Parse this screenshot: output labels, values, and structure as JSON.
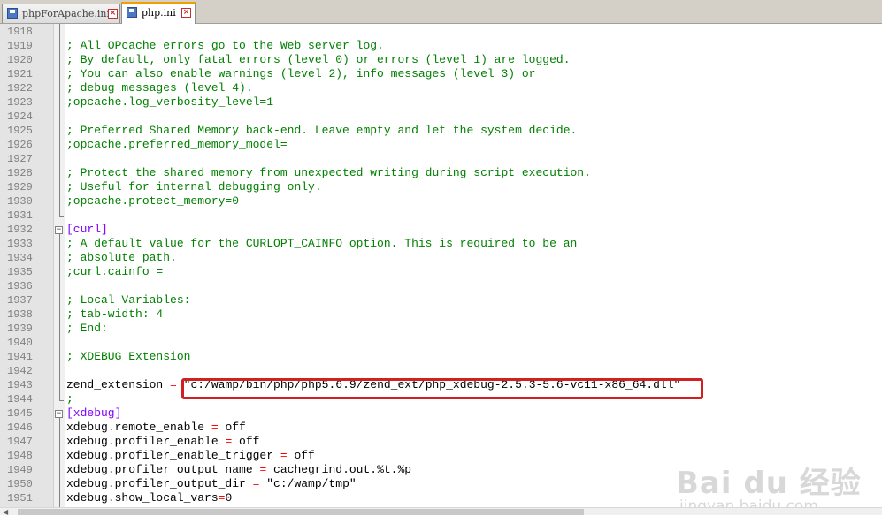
{
  "tabs": [
    {
      "label": "phpForApache.ini",
      "active": false
    },
    {
      "label": "php.ini",
      "active": true
    }
  ],
  "lines": [
    {
      "n": "1918",
      "parts": []
    },
    {
      "n": "1919",
      "parts": [
        {
          "t": "; All OPcache errors go to the Web server log.",
          "c": "c-comment"
        }
      ]
    },
    {
      "n": "1920",
      "parts": [
        {
          "t": "; By default, only fatal errors (level 0) or errors (level 1) are logged.",
          "c": "c-comment"
        }
      ]
    },
    {
      "n": "1921",
      "parts": [
        {
          "t": "; You can also enable warnings (level 2), info messages (level 3) or",
          "c": "c-comment"
        }
      ]
    },
    {
      "n": "1922",
      "parts": [
        {
          "t": "; debug messages (level 4).",
          "c": "c-comment"
        }
      ]
    },
    {
      "n": "1923",
      "parts": [
        {
          "t": ";opcache.log_verbosity_level=1",
          "c": "c-comment"
        }
      ]
    },
    {
      "n": "1924",
      "parts": []
    },
    {
      "n": "1925",
      "parts": [
        {
          "t": "; Preferred Shared Memory back-end. Leave empty and let the system decide.",
          "c": "c-comment"
        }
      ]
    },
    {
      "n": "1926",
      "parts": [
        {
          "t": ";opcache.preferred_memory_model=",
          "c": "c-comment"
        }
      ]
    },
    {
      "n": "1927",
      "parts": []
    },
    {
      "n": "1928",
      "parts": [
        {
          "t": "; Protect the shared memory from unexpected writing during script execution.",
          "c": "c-comment"
        }
      ]
    },
    {
      "n": "1929",
      "parts": [
        {
          "t": "; Useful for internal debugging only.",
          "c": "c-comment"
        }
      ]
    },
    {
      "n": "1930",
      "parts": [
        {
          "t": ";opcache.protect_memory=0",
          "c": "c-comment"
        }
      ]
    },
    {
      "n": "1931",
      "parts": []
    },
    {
      "n": "1932",
      "parts": [
        {
          "t": "[curl]",
          "c": "c-section"
        }
      ]
    },
    {
      "n": "1933",
      "parts": [
        {
          "t": "; A default value for the CURLOPT_CAINFO option. This is required to be an",
          "c": "c-comment"
        }
      ]
    },
    {
      "n": "1934",
      "parts": [
        {
          "t": "; absolute path.",
          "c": "c-comment"
        }
      ]
    },
    {
      "n": "1935",
      "parts": [
        {
          "t": ";curl.cainfo =",
          "c": "c-comment"
        }
      ]
    },
    {
      "n": "1936",
      "parts": []
    },
    {
      "n": "1937",
      "parts": [
        {
          "t": "; Local Variables:",
          "c": "c-comment"
        }
      ]
    },
    {
      "n": "1938",
      "parts": [
        {
          "t": "; tab-width: 4",
          "c": "c-comment"
        }
      ]
    },
    {
      "n": "1939",
      "parts": [
        {
          "t": "; End:",
          "c": "c-comment"
        }
      ]
    },
    {
      "n": "1940",
      "parts": []
    },
    {
      "n": "1941",
      "parts": [
        {
          "t": "; XDEBUG Extension",
          "c": "c-comment"
        }
      ]
    },
    {
      "n": "1942",
      "parts": []
    },
    {
      "n": "1943",
      "parts": [
        {
          "t": "zend_extension ",
          "c": "c-key"
        },
        {
          "t": "=",
          "c": "c-op"
        },
        {
          "t": " \"c:/wamp/bin/php/php5.6.9/zend_ext/php_xdebug-2.5.3-5.6-vc11-x86_64.dll\"",
          "c": "c-val"
        }
      ]
    },
    {
      "n": "1944",
      "parts": [
        {
          "t": ";",
          "c": "c-comment"
        }
      ]
    },
    {
      "n": "1945",
      "parts": [
        {
          "t": "[xdebug]",
          "c": "c-section"
        }
      ]
    },
    {
      "n": "1946",
      "parts": [
        {
          "t": "xdebug.remote_enable ",
          "c": "c-key"
        },
        {
          "t": "=",
          "c": "c-op"
        },
        {
          "t": " off",
          "c": "c-val"
        }
      ]
    },
    {
      "n": "1947",
      "parts": [
        {
          "t": "xdebug.profiler_enable ",
          "c": "c-key"
        },
        {
          "t": "=",
          "c": "c-op"
        },
        {
          "t": " off",
          "c": "c-val"
        }
      ]
    },
    {
      "n": "1948",
      "parts": [
        {
          "t": "xdebug.profiler_enable_trigger ",
          "c": "c-key"
        },
        {
          "t": "=",
          "c": "c-op"
        },
        {
          "t": " off",
          "c": "c-val"
        }
      ]
    },
    {
      "n": "1949",
      "parts": [
        {
          "t": "xdebug.profiler_output_name ",
          "c": "c-key"
        },
        {
          "t": "=",
          "c": "c-op"
        },
        {
          "t": " cachegrind.out.%t.%p",
          "c": "c-val"
        }
      ]
    },
    {
      "n": "1950",
      "parts": [
        {
          "t": "xdebug.profiler_output_dir ",
          "c": "c-key"
        },
        {
          "t": "=",
          "c": "c-op"
        },
        {
          "t": " \"c:/wamp/tmp\"",
          "c": "c-val"
        }
      ]
    },
    {
      "n": "1951",
      "parts": [
        {
          "t": "xdebug.show_local_vars",
          "c": "c-key"
        },
        {
          "t": "=",
          "c": "c-op"
        },
        {
          "t": "0",
          "c": "c-val"
        }
      ]
    }
  ],
  "colors": {
    "comment": "#008000",
    "section": "#8000ff",
    "operator": "#ff0000",
    "highlight_box": "#d02020",
    "active_tab_accent": "#f0a000"
  },
  "icons": {
    "tab_file": "save-disk-icon",
    "tab_close": "close-icon",
    "fold": "fold-minus-icon"
  },
  "watermark": {
    "main": "Bai du 经验",
    "sub": "jingyan.baidu.com"
  }
}
